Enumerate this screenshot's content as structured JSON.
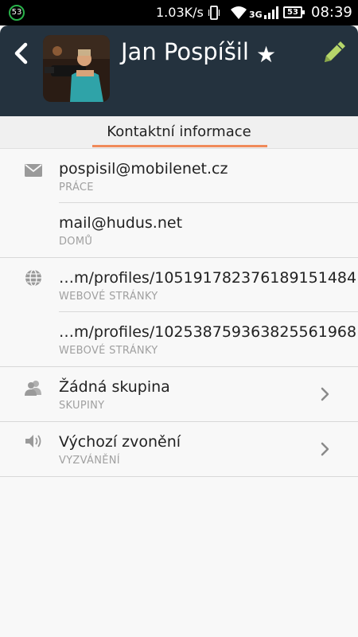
{
  "status_bar": {
    "notification_count": "53",
    "speed": "1.03K/s",
    "network": "3G",
    "battery": "53",
    "time": "08:39"
  },
  "header": {
    "name": "Jan Pospíšil",
    "favorite_icon": "star-icon",
    "back_icon": "chevron-left-icon",
    "edit_icon": "pencil-icon",
    "background_color": "#24323e",
    "edit_color": "#b6d66a"
  },
  "tab": {
    "label": "Kontaktní informace",
    "accent_color": "#f08a5a"
  },
  "items": [
    {
      "value": "pospisil@mobilenet.cz",
      "label": "PRÁCE",
      "icon": "mail-icon"
    },
    {
      "value": "mail@hudus.net",
      "label": "DOMŮ",
      "icon": ""
    },
    {
      "value": "…m/profiles/105191782376189151484",
      "label": "WEBOVÉ STRÁNKY",
      "icon": "globe-icon"
    },
    {
      "value": "…m/profiles/102538759363825561968",
      "label": "WEBOVÉ STRÁNKY",
      "icon": ""
    },
    {
      "value": "Žádná skupina",
      "label": "SKUPINY",
      "icon": "group-icon"
    },
    {
      "value": "Výchozí zvonění",
      "label": "VYZVÁNĚNÍ",
      "icon": "speaker-icon"
    }
  ]
}
